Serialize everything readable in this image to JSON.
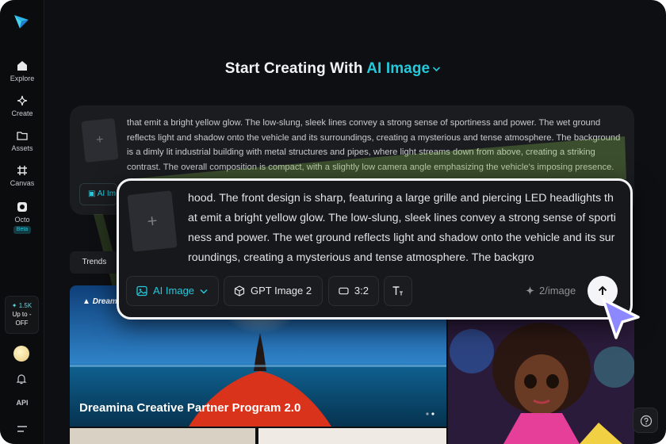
{
  "header": {
    "title_prefix": "Start Creating With",
    "title_accent": "AI Image"
  },
  "sidebar": {
    "items": [
      {
        "label": "Explore",
        "icon": "home-icon"
      },
      {
        "label": "Create",
        "icon": "sparkle-icon"
      },
      {
        "label": "Assets",
        "icon": "folder-icon"
      },
      {
        "label": "Canvas",
        "icon": "hash-icon"
      },
      {
        "label": "Octo",
        "icon": "octo-icon"
      }
    ],
    "octo_badge": "Beta",
    "promo": {
      "credits": "1.5K",
      "line1": "Up to -",
      "line2": "OFF"
    },
    "api_label": "API"
  },
  "background_composer": {
    "text": "that emit a bright yellow glow. The low-slung, sleek lines convey a strong sense of sportiness and power. The wet ground reflects light and shadow onto the vehicle and its surroundings, creating a mysterious and tense atmosphere. The background is a dimly lit industrial building with metal structures and pipes, where light streams down from above, creating a striking contrast. The overall composition is compact, with a slightly low camera angle emphasizing the vehicle's imposing presence.",
    "chip_label": "AI Im"
  },
  "composer": {
    "prompt_text": "hood. The front design is sharp, featuring a large grille and piercing LED headlights that emit a bright yellow glow. The low-slung, sleek lines convey a strong sense of sportiness and power. The wet ground reflects light and shadow onto the vehicle and its surroundings, creating a mysterious and tense atmosphere. The backgro",
    "mode_label": "AI Image",
    "model_label": "GPT Image 2",
    "ratio_label": "3:2",
    "cost_label": "2/image"
  },
  "filters": {
    "trends_label": "Trends"
  },
  "gallery": {
    "banner_title": "Dreamina Creative Partner Program 2.0",
    "banner_brand": "Dreamin"
  },
  "colors": {
    "accent": "#24c9dc",
    "background": "#0e0f12",
    "highlight_green": "#8fd14f"
  }
}
